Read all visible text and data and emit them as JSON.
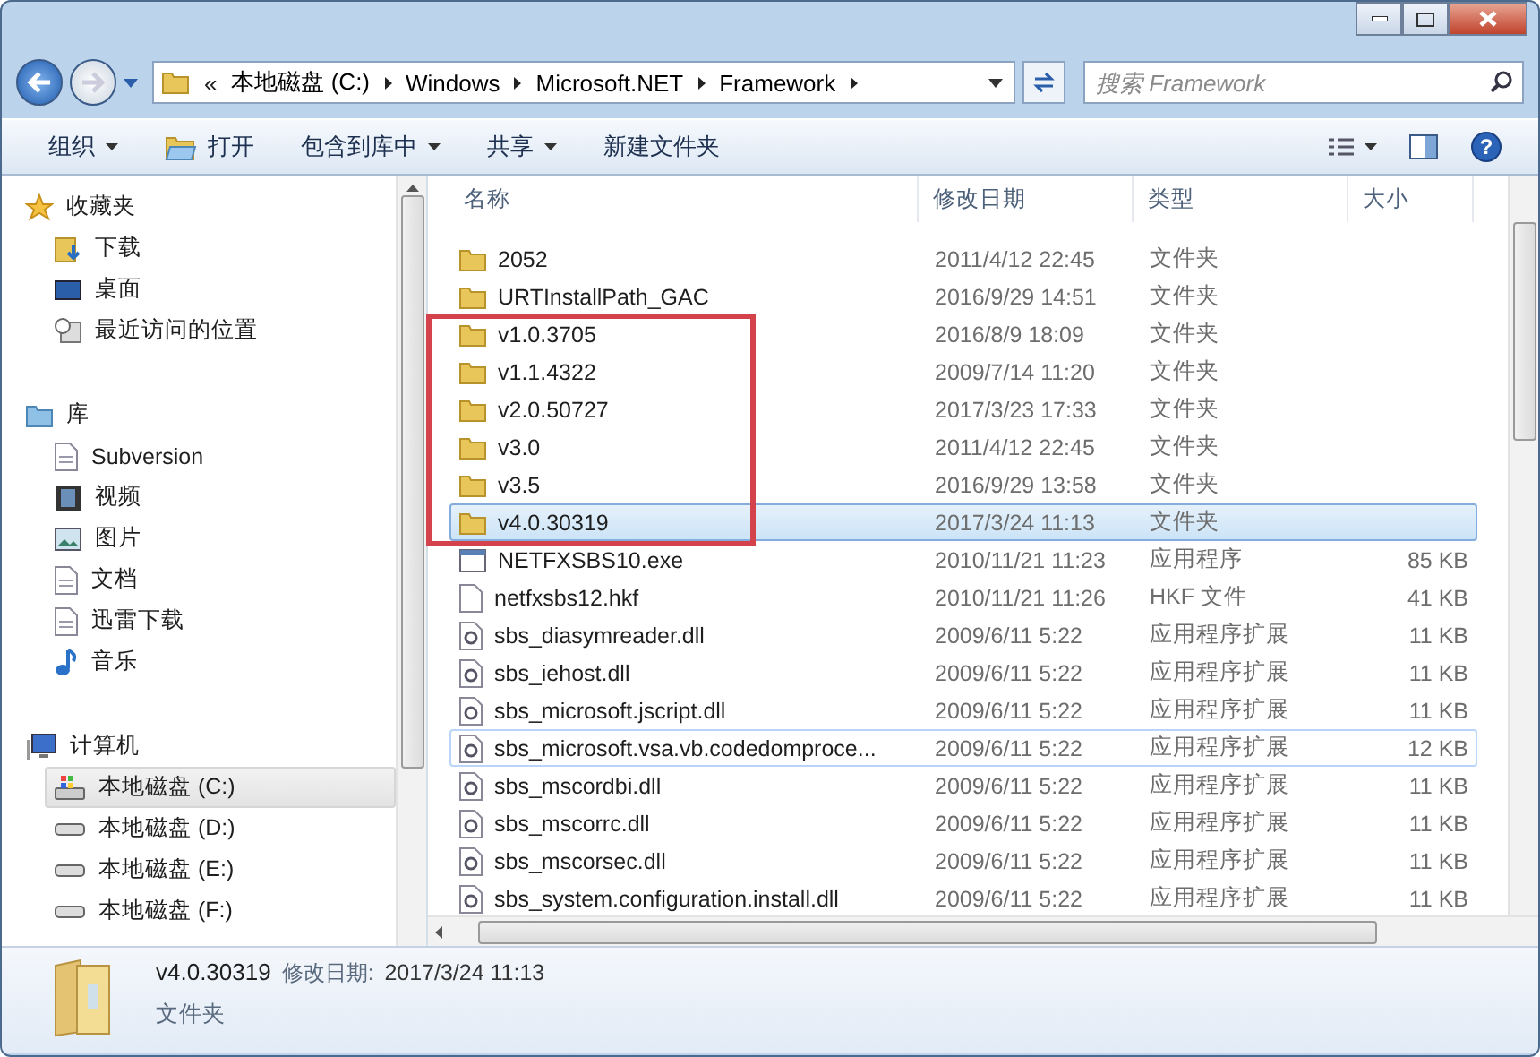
{
  "address_bar": {
    "overflow": "«",
    "segments": [
      "本地磁盘 (C:)",
      "Windows",
      "Microsoft.NET",
      "Framework"
    ]
  },
  "search": {
    "placeholder": "搜索 Framework"
  },
  "toolbar": {
    "items": [
      {
        "label": "组织",
        "kind": "menu"
      },
      {
        "label": "打开",
        "kind": "icon"
      },
      {
        "label": "包含到库中",
        "kind": "menu"
      },
      {
        "label": "共享",
        "kind": "menu"
      },
      {
        "label": "新建文件夹",
        "kind": "plain"
      }
    ],
    "help": "?"
  },
  "sidebar": {
    "groups": [
      {
        "label": "收藏夹",
        "kind": "favorites",
        "children": [
          {
            "label": "下载",
            "kind": "download",
            "selected": false
          },
          {
            "label": "桌面",
            "kind": "desktop",
            "selected": false
          },
          {
            "label": "最近访问的位置",
            "kind": "recent",
            "selected": false
          }
        ]
      },
      {
        "label": "库",
        "kind": "library",
        "children": [
          {
            "label": "Subversion",
            "kind": "doc",
            "selected": false
          },
          {
            "label": "视频",
            "kind": "video",
            "selected": false
          },
          {
            "label": "图片",
            "kind": "picture",
            "selected": false
          },
          {
            "label": "文档",
            "kind": "doc",
            "selected": false
          },
          {
            "label": "迅雷下载",
            "kind": "doc",
            "selected": false
          },
          {
            "label": "音乐",
            "kind": "music",
            "selected": false
          }
        ]
      },
      {
        "label": "计算机",
        "kind": "computer",
        "children": [
          {
            "label": "本地磁盘 (C:)",
            "kind": "sysdrive",
            "selected": true
          },
          {
            "label": "本地磁盘 (D:)",
            "kind": "drive",
            "selected": false
          },
          {
            "label": "本地磁盘 (E:)",
            "kind": "drive",
            "selected": false
          },
          {
            "label": "本地磁盘 (F:)",
            "kind": "drive",
            "selected": false
          }
        ]
      }
    ]
  },
  "file_list": {
    "columns": [
      "名称",
      "修改日期",
      "类型",
      "大小"
    ],
    "rows": [
      {
        "name": "2052",
        "date": "2011/4/12 22:45",
        "type": "文件夹",
        "kind": "folder",
        "selected": false,
        "hovered": false,
        "marked": false
      },
      {
        "name": "URTInstallPath_GAC",
        "date": "2016/9/29 14:51",
        "type": "文件夹",
        "kind": "folder",
        "selected": false,
        "hovered": false,
        "marked": false
      },
      {
        "name": "v1.0.3705",
        "date": "2016/8/9 18:09",
        "type": "文件夹",
        "kind": "folder",
        "selected": false,
        "hovered": false,
        "marked": true
      },
      {
        "name": "v1.1.4322",
        "date": "2009/7/14 11:20",
        "type": "文件夹",
        "kind": "folder",
        "selected": false,
        "hovered": false,
        "marked": true
      },
      {
        "name": "v2.0.50727",
        "date": "2017/3/23 17:33",
        "type": "文件夹",
        "kind": "folder",
        "selected": false,
        "hovered": false,
        "marked": true
      },
      {
        "name": "v3.0",
        "date": "2011/4/12 22:45",
        "type": "文件夹",
        "kind": "folder",
        "selected": false,
        "hovered": false,
        "marked": true
      },
      {
        "name": "v3.5",
        "date": "2016/9/29 13:58",
        "type": "文件夹",
        "kind": "folder",
        "selected": false,
        "hovered": false,
        "marked": true
      },
      {
        "name": "v4.0.30319",
        "date": "2017/3/24 11:13",
        "type": "文件夹",
        "kind": "folder",
        "selected": true,
        "hovered": false,
        "marked": true
      },
      {
        "name": "NETFXSBS10.exe",
        "date": "2010/11/21 11:23",
        "type": "应用程序",
        "size": "85 KB",
        "kind": "exe",
        "selected": false,
        "hovered": false,
        "marked": false
      },
      {
        "name": "netfxsbs12.hkf",
        "date": "2010/11/21 11:26",
        "type": "HKF 文件",
        "size": "41 KB",
        "kind": "file",
        "selected": false,
        "hovered": false,
        "marked": false
      },
      {
        "name": "sbs_diasymreader.dll",
        "date": "2009/6/11 5:22",
        "type": "应用程序扩展",
        "size": "11 KB",
        "kind": "dll",
        "selected": false,
        "hovered": false,
        "marked": false
      },
      {
        "name": "sbs_iehost.dll",
        "date": "2009/6/11 5:22",
        "type": "应用程序扩展",
        "size": "11 KB",
        "kind": "dll",
        "selected": false,
        "hovered": false,
        "marked": false
      },
      {
        "name": "sbs_microsoft.jscript.dll",
        "date": "2009/6/11 5:22",
        "type": "应用程序扩展",
        "size": "11 KB",
        "kind": "dll",
        "selected": false,
        "hovered": false,
        "marked": false
      },
      {
        "name": "sbs_microsoft.vsa.vb.codedomproce...",
        "date": "2009/6/11 5:22",
        "type": "应用程序扩展",
        "size": "12 KB",
        "kind": "dll",
        "selected": false,
        "hovered": true,
        "marked": false
      },
      {
        "name": "sbs_mscordbi.dll",
        "date": "2009/6/11 5:22",
        "type": "应用程序扩展",
        "size": "11 KB",
        "kind": "dll",
        "selected": false,
        "hovered": false,
        "marked": false
      },
      {
        "name": "sbs_mscorrc.dll",
        "date": "2009/6/11 5:22",
        "type": "应用程序扩展",
        "size": "11 KB",
        "kind": "dll",
        "selected": false,
        "hovered": false,
        "marked": false
      },
      {
        "name": "sbs_mscorsec.dll",
        "date": "2009/6/11 5:22",
        "type": "应用程序扩展",
        "size": "11 KB",
        "kind": "dll",
        "selected": false,
        "hovered": false,
        "marked": false
      },
      {
        "name": "sbs_system.configuration.install.dll",
        "date": "2009/6/11 5:22",
        "type": "应用程序扩展",
        "size": "11 KB",
        "kind": "dll",
        "selected": false,
        "hovered": false,
        "marked": false
      }
    ]
  },
  "details_pane": {
    "name": "v4.0.30319",
    "date_label": "修改日期:",
    "date": "2017/3/24 11:13",
    "type": "文件夹"
  }
}
